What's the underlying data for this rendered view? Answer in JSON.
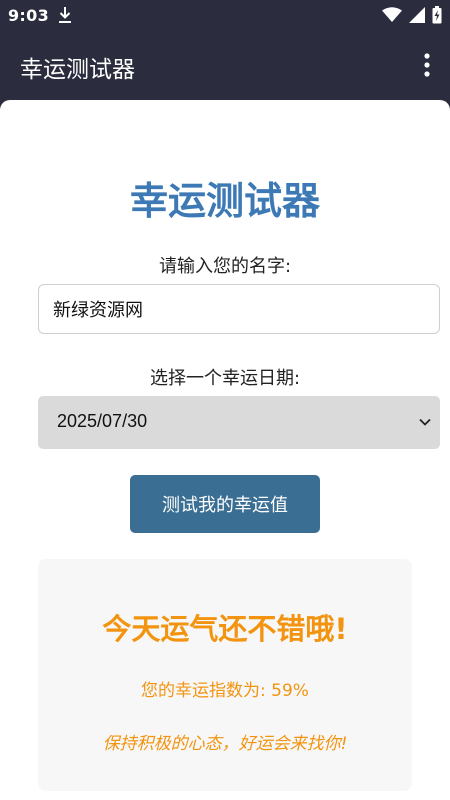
{
  "status_bar": {
    "time": "9:03"
  },
  "app_bar": {
    "title": "幸运测试器"
  },
  "main": {
    "heading": "幸运测试器",
    "name_label": "请输入您的名字:",
    "name_value": "新绿资源网",
    "date_label": "选择一个幸运日期:",
    "date_value": "2025/07/30",
    "button_label": "测试我的幸运值"
  },
  "result": {
    "title": "今天运气还不错哦!",
    "score_text": "您的幸运指数为: 59%",
    "message": "保持积极的心态，好运会来找你!"
  },
  "colors": {
    "bar_bg": "#2b2d3e",
    "heading": "#3d7ab5",
    "button": "#3a6e93",
    "result_text": "#f39410"
  }
}
